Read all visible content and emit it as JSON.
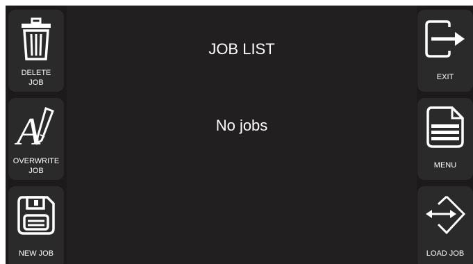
{
  "title": "JOB LIST",
  "empty_message": "No jobs",
  "left_buttons": [
    {
      "label": "DELETE\nJOB",
      "icon": "trash-icon"
    },
    {
      "label": "OVERWRITE\nJOB",
      "icon": "pen-a-icon"
    },
    {
      "label": "NEW JOB",
      "icon": "floppy-disk-icon"
    }
  ],
  "right_buttons": [
    {
      "label": "EXIT",
      "icon": "exit-icon"
    },
    {
      "label": "MENU",
      "icon": "document-menu-icon"
    },
    {
      "label": "LOAD JOB",
      "icon": "load-arrow-icon"
    }
  ],
  "colors": {
    "background": "#1c1a1b",
    "button": "#2b2a2a",
    "text": "#ffffff"
  }
}
